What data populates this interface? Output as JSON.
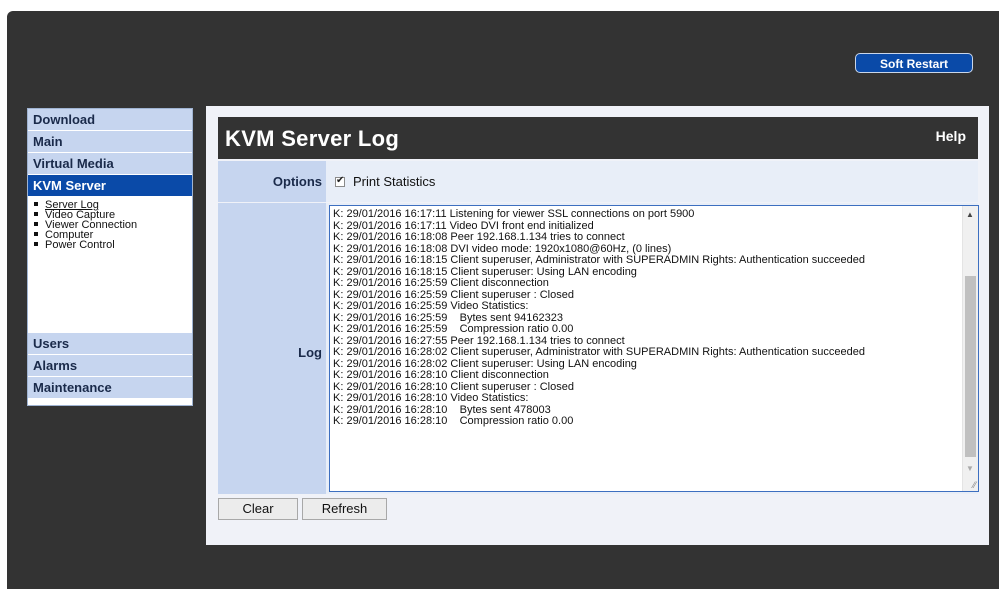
{
  "header": {
    "soft_restart_label": "Soft Restart"
  },
  "sidebar": {
    "top_items": [
      {
        "label": "Download"
      },
      {
        "label": "Main"
      },
      {
        "label": "Virtual Media"
      },
      {
        "label": "KVM Server"
      }
    ],
    "subitems": [
      {
        "label": "Server Log"
      },
      {
        "label": "Video Capture"
      },
      {
        "label": "Viewer Connection"
      },
      {
        "label": "Computer"
      },
      {
        "label": "Power Control"
      }
    ],
    "bottom_items": [
      {
        "label": "Users"
      },
      {
        "label": "Alarms"
      },
      {
        "label": "Maintenance"
      }
    ]
  },
  "page": {
    "title": "KVM Server Log",
    "help_label": "Help",
    "options_label": "Options",
    "print_statistics_label": "Print Statistics",
    "print_statistics_checked": true,
    "log_label": "Log",
    "log_text": "K: 29/01/2016 16:17:11 Listening for viewer SSL connections on port 5900\nK: 29/01/2016 16:17:11 Video DVI front end initialized\nK: 29/01/2016 16:18:08 Peer 192.168.1.134 tries to connect\nK: 29/01/2016 16:18:08 DVI video mode: 1920x1080@60Hz, (0 lines)\nK: 29/01/2016 16:18:15 Client superuser, Administrator with SUPERADMIN Rights: Authentication succeeded\nK: 29/01/2016 16:18:15 Client superuser: Using LAN encoding\nK: 29/01/2016 16:25:59 Client disconnection\nK: 29/01/2016 16:25:59 Client superuser : Closed\nK: 29/01/2016 16:25:59 Video Statistics:\nK: 29/01/2016 16:25:59    Bytes sent 94162323\nK: 29/01/2016 16:25:59    Compression ratio 0.00\nK: 29/01/2016 16:27:55 Peer 192.168.1.134 tries to connect\nK: 29/01/2016 16:28:02 Client superuser, Administrator with SUPERADMIN Rights: Authentication succeeded\nK: 29/01/2016 16:28:02 Client superuser: Using LAN encoding\nK: 29/01/2016 16:28:10 Client disconnection\nK: 29/01/2016 16:28:10 Client superuser : Closed\nK: 29/01/2016 16:28:10 Video Statistics:\nK: 29/01/2016 16:28:10    Bytes sent 478003\nK: 29/01/2016 16:28:10    Compression ratio 0.00",
    "clear_label": "Clear",
    "refresh_label": "Refresh"
  },
  "colors": {
    "frame_bg": "#333333",
    "nav_bg": "#c6d5ef",
    "nav_active_bg": "#0a4aa8",
    "content_bg": "#f0f2f8",
    "button_blue": "#0a4aa8"
  },
  "icons": {
    "checkbox": "checkmark-icon",
    "scroll_up": "scroll-up-arrow-icon",
    "scroll_down": "scroll-down-arrow-icon",
    "resize": "resize-grip-icon"
  }
}
